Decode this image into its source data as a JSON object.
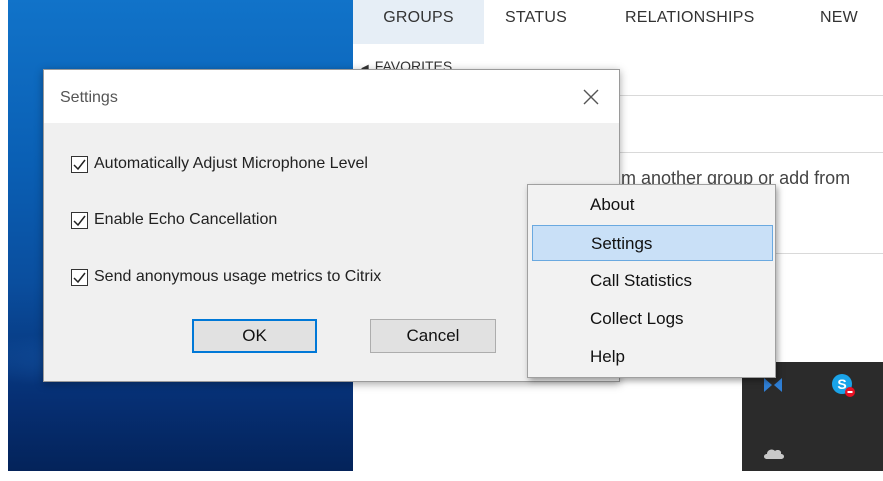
{
  "background_app": {
    "tabs": [
      "GROUPS",
      "STATUS",
      "RELATIONSHIPS",
      "NEW"
    ],
    "favorites_label": "FAVORITES",
    "body_text": "m another group or add from"
  },
  "settings_dialog": {
    "title": "Settings",
    "checkboxes": [
      {
        "label": "Automatically Adjust Microphone Level",
        "checked": true
      },
      {
        "label": "Enable Echo Cancellation",
        "checked": true
      },
      {
        "label": "Send anonymous usage metrics to Citrix",
        "checked": true
      }
    ],
    "ok_label": "OK",
    "cancel_label": "Cancel"
  },
  "context_menu": {
    "items": [
      "About",
      "Settings",
      "Call Statistics",
      "Collect Logs",
      "Help"
    ],
    "selected": "Settings"
  },
  "tray": {
    "icons": [
      "citrix-icon",
      "skype-icon",
      "onedrive-icon"
    ]
  },
  "colors": {
    "accent": "#0078d7",
    "menu_highlight": "#c9e0f7",
    "wallpaper": "#0a5fb4",
    "tray": "#2b2b2b"
  }
}
